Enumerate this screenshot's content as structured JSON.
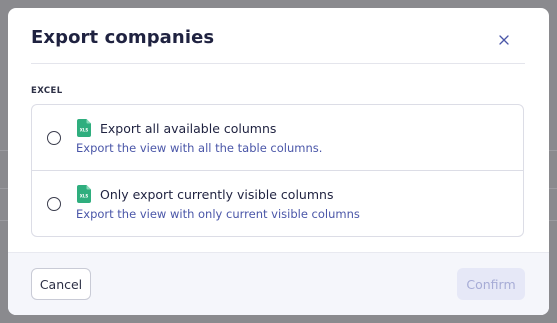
{
  "dialog": {
    "title": "Export companies",
    "close_icon": "close-icon"
  },
  "section": {
    "label": "EXCEL"
  },
  "options": [
    {
      "title": "Export all available columns",
      "description": "Export the view with all the table columns.",
      "icon": "xls-file-icon",
      "selected": false
    },
    {
      "title": "Only export currently visible columns",
      "description": "Export the view with only current visible columns",
      "icon": "xls-file-icon",
      "selected": false
    }
  ],
  "footer": {
    "cancel_label": "Cancel",
    "confirm_label": "Confirm",
    "confirm_disabled": true
  },
  "colors": {
    "title": "#1f2240",
    "description": "#4a56a8",
    "xls_icon": "#2fae7e",
    "confirm_bg": "#e6e8f7",
    "confirm_text": "#a7acd6"
  }
}
